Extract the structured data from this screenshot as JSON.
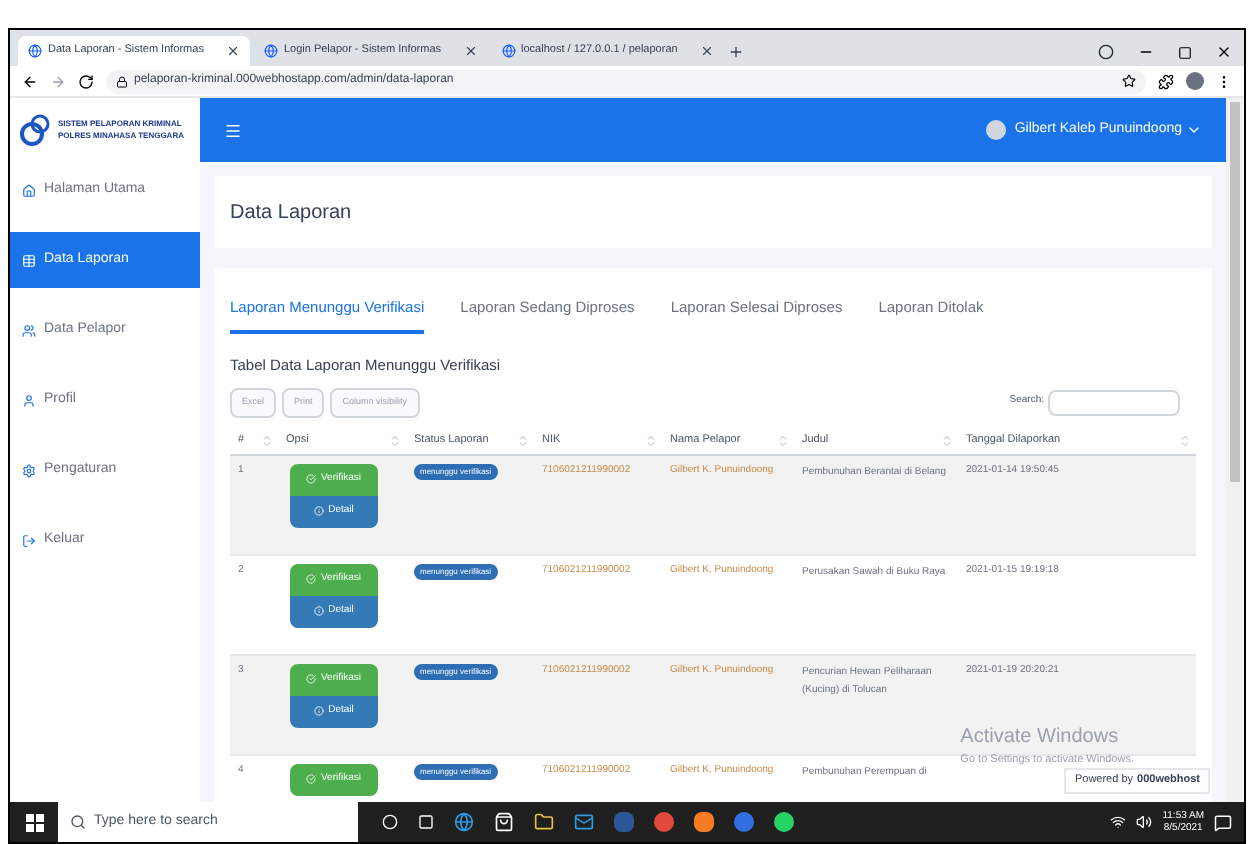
{
  "browser": {
    "tabs": [
      {
        "title": "Data Laporan - Sistem Informas",
        "selected": true
      },
      {
        "title": "Login Pelapor - Sistem Informas",
        "selected": false
      },
      {
        "title": "localhost / 127.0.0.1 / pelaporan",
        "selected": false
      }
    ],
    "url": "pelaporan-kriminal.000webhostapp.com/admin/data-laporan"
  },
  "app": {
    "logo_line1": "SISTEM PELAPORAN KRIMINAL",
    "logo_line2": "POLRES MINAHASA TENGGARA",
    "user": "Gilbert Kaleb Punuindoong"
  },
  "sidebar": {
    "items": [
      {
        "label": "Halaman Utama",
        "selected": false
      },
      {
        "label": "Data Laporan",
        "selected": true
      },
      {
        "label": "Data Pelapor",
        "selected": false
      },
      {
        "label": "Profil",
        "selected": false
      },
      {
        "label": "Pengaturan",
        "selected": false
      },
      {
        "label": "Keluar",
        "selected": false
      }
    ]
  },
  "page_title": "Data Laporan",
  "tabs": [
    {
      "label": "Laporan Menunggu Verifikasi",
      "selected": true
    },
    {
      "label": "Laporan Sedang Diproses",
      "selected": false
    },
    {
      "label": "Laporan Selesai Diproses",
      "selected": false
    },
    {
      "label": "Laporan Ditolak",
      "selected": false
    }
  ],
  "table_title": "Tabel Data Laporan Menunggu Verifikasi",
  "export_buttons": [
    "Excel",
    "Print",
    "Column visibility"
  ],
  "search_label": "Search:",
  "table": {
    "columns": [
      "#",
      "Opsi",
      "Status Laporan",
      "NIK",
      "Nama Pelapor",
      "Judul",
      "Tanggal Dilaporkan"
    ],
    "rows": [
      {
        "no": "1",
        "verify": "Verifikasi",
        "detail": "Detail",
        "status": "menunggu verifikasi",
        "nik": "7106021211990002",
        "name": "Gilbert K. Punuindoong",
        "title": "Pembunuhan Berantai di Belang",
        "date": "2021-01-14 19:50:45"
      },
      {
        "no": "2",
        "verify": "Verifikasi",
        "detail": "Detail",
        "status": "menunggu verifikasi",
        "nik": "7106021211990002",
        "name": "Gilbert K. Punuindoong",
        "title": "Perusakan Sawah di Buku Raya",
        "date": "2021-01-15 19:19:18"
      },
      {
        "no": "3",
        "verify": "Verifikasi",
        "detail": "Detail",
        "status": "menunggu verifikasi",
        "nik": "7106021211990002",
        "name": "Gilbert K. Punuindoong",
        "title": "Pencurian Hewan Peliharaan (Kucing) di Tolucan",
        "date": "2021-01-19 20:20:21"
      },
      {
        "no": "4",
        "verify": "Verifikasi",
        "status": "menunggu verifikasi",
        "nik": "7106021211990002",
        "name": "Gilbert K. Punuindoong",
        "title": "Pembunuhan Perempuan di"
      }
    ]
  },
  "activation": {
    "title": "Activate Windows",
    "subtitle": "Go to Settings to activate Windows."
  },
  "badge": {
    "prefix": "Powered by",
    "brand": "000webhost"
  },
  "taskbar": {
    "search_placeholder": "Type here to search",
    "time": "11:53 AM",
    "date": "8/5/2021"
  }
}
